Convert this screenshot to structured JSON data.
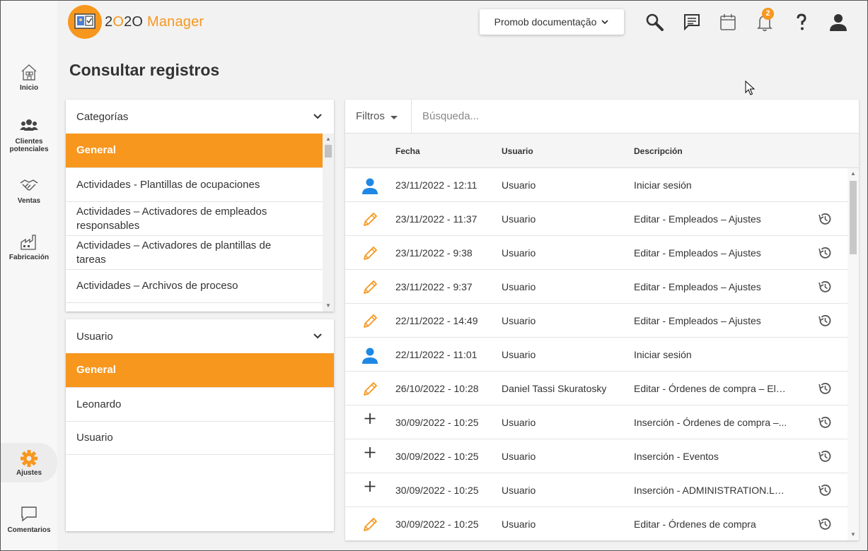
{
  "app": {
    "logo_prefix": "2",
    "logo_o": "O",
    "logo_suffix": "2O",
    "logo_manager": "Manager",
    "brand_color": "#f7971e"
  },
  "nav": {
    "items": [
      {
        "label": "Inicio",
        "icon": "home-icon"
      },
      {
        "label_line1": "Clientes",
        "label_line2": "potenciales",
        "icon": "people-icon"
      },
      {
        "label": "Ventas",
        "icon": "handshake-icon"
      },
      {
        "label": "Fabricación",
        "icon": "factory-icon"
      },
      {
        "label": "Ajustes",
        "icon": "gear-icon",
        "active": true
      },
      {
        "label": "Comentarios",
        "icon": "comment-icon"
      }
    ]
  },
  "topbar": {
    "doc_button": "Promob documentação",
    "notification_count": "2",
    "icons": [
      "search-icon",
      "chat-icon",
      "calendar-icon",
      "bell-icon",
      "help-icon",
      "user-icon"
    ]
  },
  "page": {
    "title": "Consultar registros"
  },
  "categories": {
    "header": "Categorías",
    "items": [
      {
        "label": "General",
        "selected": true
      },
      {
        "label": "Actividades - Plantillas de ocupaciones"
      },
      {
        "label": "Actividades – Activadores de empleados responsables"
      },
      {
        "label": "Actividades – Activadores de plantillas de tareas"
      },
      {
        "label": "Actividades – Archivos de proceso"
      }
    ]
  },
  "users": {
    "header": "Usuario",
    "items": [
      {
        "label": "General",
        "selected": true
      },
      {
        "label": "Leonardo"
      },
      {
        "label": "Usuario"
      }
    ]
  },
  "log": {
    "filter_label": "Filtros",
    "search_placeholder": "Búsqueda...",
    "columns": {
      "date": "Fecha",
      "user": "Usuario",
      "description": "Descripción"
    },
    "rows": [
      {
        "type": "login",
        "date": "23/11/2022 - 12:11",
        "user": "Usuario",
        "description": "Iniciar sesión",
        "history": false
      },
      {
        "type": "edit",
        "date": "23/11/2022 - 11:37",
        "user": "Usuario",
        "description": "Editar - Empleados – Ajustes",
        "history": true
      },
      {
        "type": "edit",
        "date": "23/11/2022 - 9:38",
        "user": "Usuario",
        "description": "Editar - Empleados – Ajustes",
        "history": true
      },
      {
        "type": "edit",
        "date": "23/11/2022 - 9:37",
        "user": "Usuario",
        "description": "Editar - Empleados – Ajustes",
        "history": true
      },
      {
        "type": "edit",
        "date": "22/11/2022 - 14:49",
        "user": "Usuario",
        "description": "Editar - Empleados – Ajustes",
        "history": true
      },
      {
        "type": "login",
        "date": "22/11/2022 - 11:01",
        "user": "Usuario",
        "description": "Iniciar sesión",
        "history": false
      },
      {
        "type": "edit",
        "date": "26/10/2022 - 10:28",
        "user": "Daniel Tassi Skuratosky",
        "description": "Editar - Órdenes de compra – Ele...",
        "history": true
      },
      {
        "type": "insert",
        "date": "30/09/2022 - 10:25",
        "user": "Usuario",
        "description": "Inserción - Órdenes de compra –...",
        "history": true
      },
      {
        "type": "insert",
        "date": "30/09/2022 - 10:25",
        "user": "Usuario",
        "description": "Inserción - Eventos",
        "history": true
      },
      {
        "type": "insert",
        "date": "30/09/2022 - 10:25",
        "user": "Usuario",
        "description": "Inserción - ADMINISTRATION.LO...",
        "history": true
      },
      {
        "type": "edit",
        "date": "30/09/2022 - 10:25",
        "user": "Usuario",
        "description": "Editar - Órdenes de compra",
        "history": true
      }
    ]
  }
}
